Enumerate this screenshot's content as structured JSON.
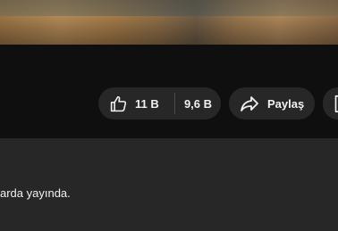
{
  "video": {
    "thumbnail_icon": "video-frame"
  },
  "actions": {
    "like_count": "11 B",
    "dislike_count": "9,6 B",
    "share_label": "Paylaş",
    "like_icon": "thumbs-up-icon",
    "share_icon": "share-arrow-icon",
    "cut_icon": "save-or-clip-icon"
  },
  "description": {
    "text": "arda yayında."
  },
  "colors": {
    "page_bg": "#0f0f0f",
    "pill_bg": "#272727",
    "text": "#f1f1f1",
    "description_bg": "#272727"
  }
}
